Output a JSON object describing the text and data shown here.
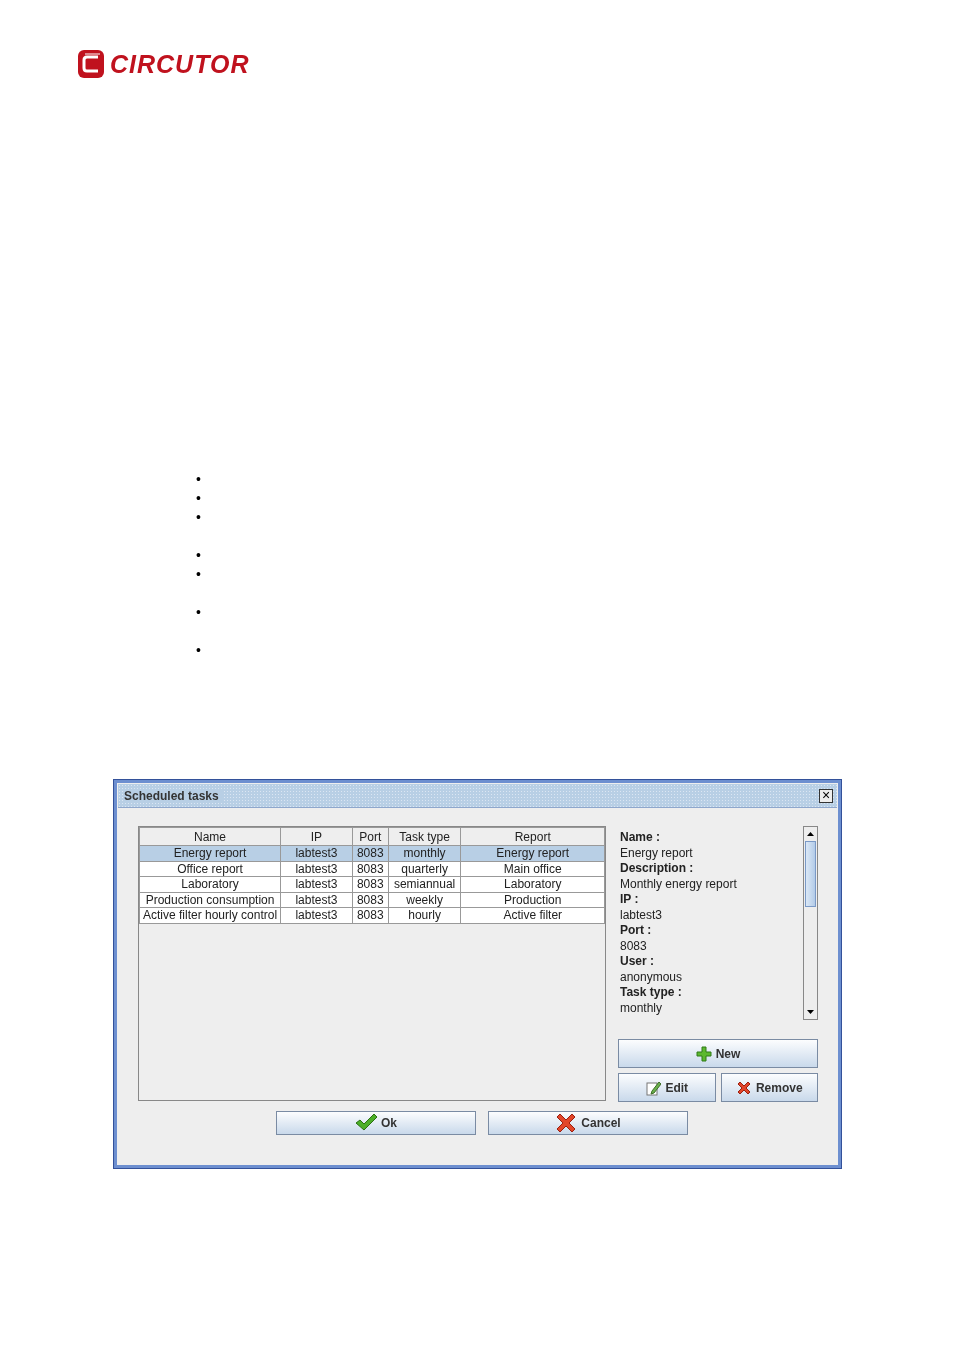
{
  "logo": {
    "text": "CIRCUTOR"
  },
  "bullet_groups": [
    [
      "•",
      "•",
      "•"
    ],
    [
      "•",
      "•"
    ],
    [
      "•"
    ],
    [
      "•"
    ]
  ],
  "dialog": {
    "title": "Scheduled tasks",
    "close": "×",
    "table": {
      "columns": [
        "Name",
        "IP",
        "Port",
        "Task type",
        "Report"
      ],
      "rows": [
        {
          "cells": [
            "Energy report",
            "labtest3",
            "8083",
            "monthly",
            "Energy report"
          ],
          "selected": true
        },
        {
          "cells": [
            "Office report",
            "labtest3",
            "8083",
            "quarterly",
            "Main office"
          ],
          "selected": false
        },
        {
          "cells": [
            "Laboratory",
            "labtest3",
            "8083",
            "semiannual",
            "Laboratory"
          ],
          "selected": false
        },
        {
          "cells": [
            "Production consumption",
            "labtest3",
            "8083",
            "weekly",
            "Production"
          ],
          "selected": false
        },
        {
          "cells": [
            "Active filter hourly control",
            "labtest3",
            "8083",
            "hourly",
            "Active filter"
          ],
          "selected": false
        }
      ]
    },
    "details": [
      {
        "label": "Name :",
        "value": "Energy report"
      },
      {
        "label": "Description :",
        "value": "Monthly energy report"
      },
      {
        "label": "IP :",
        "value": "labtest3"
      },
      {
        "label": "Port :",
        "value": "8083"
      },
      {
        "label": "User :",
        "value": "anonymous"
      },
      {
        "label": "Task type :",
        "value": "monthly"
      }
    ],
    "side_buttons": [
      {
        "label": "New",
        "kind": "new"
      },
      {
        "label": "Edit",
        "kind": "edit"
      },
      {
        "label": "Remove",
        "kind": "remove"
      }
    ],
    "footer_buttons": [
      {
        "label": "Ok",
        "kind": "ok"
      },
      {
        "label": "Cancel",
        "kind": "cancel"
      }
    ]
  }
}
